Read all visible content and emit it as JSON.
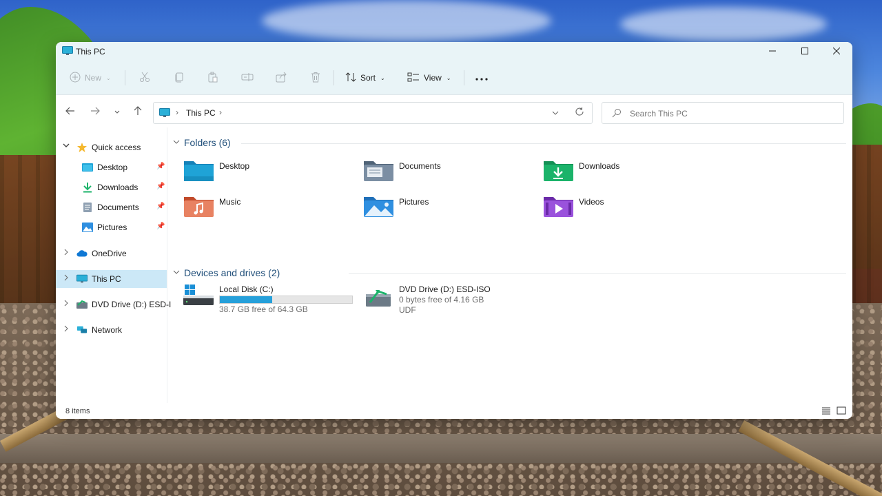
{
  "window": {
    "title": "This PC",
    "controls": {
      "minimize": "minimize-icon",
      "maximize": "maximize-icon",
      "close": "close-icon"
    }
  },
  "toolbar": {
    "new_label": "New",
    "sort_label": "Sort",
    "view_label": "View",
    "more_icon": "more-icon"
  },
  "address": {
    "crumb": "This PC",
    "separator": "›"
  },
  "search": {
    "placeholder": "Search This PC"
  },
  "nav": {
    "quick_access": "Quick access",
    "quick_items": [
      {
        "label": "Desktop",
        "icon": "desktop-folder-icon"
      },
      {
        "label": "Downloads",
        "icon": "download-arrow-icon"
      },
      {
        "label": "Documents",
        "icon": "documents-icon"
      },
      {
        "label": "Pictures",
        "icon": "pictures-icon"
      }
    ],
    "onedrive": "OneDrive",
    "this_pc": "This PC",
    "dvd": "DVD Drive (D:) ESD-I",
    "network": "Network"
  },
  "folders": {
    "header": "Folders (6)",
    "items": [
      {
        "label": "Desktop",
        "color": "#1fa3d6"
      },
      {
        "label": "Documents",
        "color": "#6b7f95"
      },
      {
        "label": "Downloads",
        "color": "#1bb36a"
      },
      {
        "label": "Music",
        "color": "#e06a3c"
      },
      {
        "label": "Pictures",
        "color": "#2f8fe0"
      },
      {
        "label": "Videos",
        "color": "#8a3fd1"
      }
    ]
  },
  "drives": {
    "header": "Devices and drives (2)",
    "items": [
      {
        "name": "Local Disk (C:)",
        "free": "38.7 GB free of 64.3 GB",
        "used_fraction": 0.398
      },
      {
        "name": "DVD Drive (D:) ESD-ISO",
        "free": "0 bytes free of 4.16 GB",
        "fs": "UDF"
      }
    ]
  },
  "status": {
    "count": "8 items"
  },
  "colors": {
    "accent": "#26a0da",
    "selection": "#cce8f7",
    "titlebar": "#e9f4f7",
    "group_header": "#1f4e79"
  }
}
